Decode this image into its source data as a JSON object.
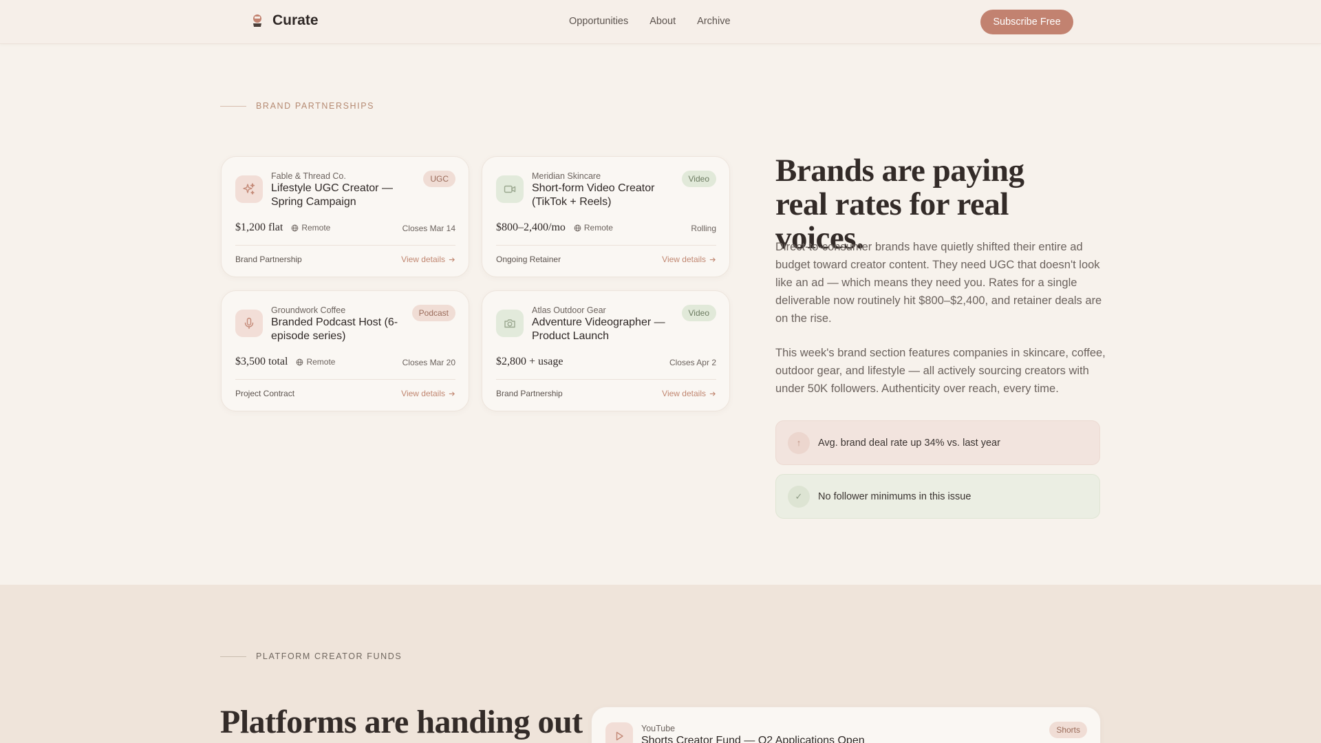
{
  "header": {
    "brand": "Curate",
    "nav": [
      "Opportunities",
      "About",
      "Archive"
    ],
    "cta": "Subscribe Free"
  },
  "brand_section": {
    "eyebrow": "BRAND PARTNERSHIPS",
    "cards": [
      {
        "company": "Fable & Thread Co.",
        "role": "Lifestyle UGC Creator — Spring Campaign",
        "tag": "UGC",
        "price": "$1,200 flat",
        "location": "Remote",
        "deadline": "Closes Mar 14",
        "type": "Brand Partnership",
        "cta": "View details",
        "icon": "sparkle-icon"
      },
      {
        "company": "Meridian Skincare",
        "role": "Short-form Video Creator (TikTok + Reels)",
        "tag": "Video",
        "price": "$800–2,400/mo",
        "location": "Remote",
        "deadline": "Rolling",
        "type": "Ongoing Retainer",
        "cta": "View details",
        "icon": "video-camera-icon"
      },
      {
        "company": "Groundwork Coffee",
        "role": "Branded Podcast Host (6-episode series)",
        "tag": "Podcast",
        "price": "$3,500 total",
        "location": "Remote",
        "deadline": "Closes Mar 20",
        "type": "Project Contract",
        "cta": "View details",
        "icon": "microphone-icon"
      },
      {
        "company": "Atlas Outdoor Gear",
        "role": "Adventure Videographer — Product Launch",
        "tag": "Video",
        "price": "$2,800 + usage",
        "location": "",
        "deadline": "Closes Apr 2",
        "type": "Brand Partnership",
        "cta": "View details",
        "icon": "camera-icon"
      }
    ],
    "headline": "Brands are paying real rates for real voices.",
    "paragraphs": [
      "Direct-to-consumer brands have quietly shifted their entire ad budget toward creator content. They need UGC that doesn't look like an ad — which means they need you. Rates for a single deliverable now routinely hit $800–$2,400, and retainer deals are on the rise.",
      "This week's brand section features companies in skincare, coffee, outdoor gear, and lifestyle — all actively sourcing creators with under 50K followers. Authenticity over reach, every time."
    ],
    "stats": [
      {
        "icon": "↑",
        "text": "Avg. brand deal rate up 34% vs. last year"
      },
      {
        "icon": "✓",
        "text": "No follower minimums in this issue"
      }
    ]
  },
  "platform_section": {
    "eyebrow": "PLATFORM CREATOR FUNDS",
    "headline": "Platforms are handing out",
    "card": {
      "company": "YouTube",
      "role": "Shorts Creator Fund — Q2 Applications Open",
      "tag": "Shorts",
      "icon": "play-icon"
    }
  },
  "colors": {
    "accent": "#c28270",
    "background": "#f7f2ec",
    "pink_tag": "#f0ddd5",
    "green_tag": "#e1e9d9"
  }
}
